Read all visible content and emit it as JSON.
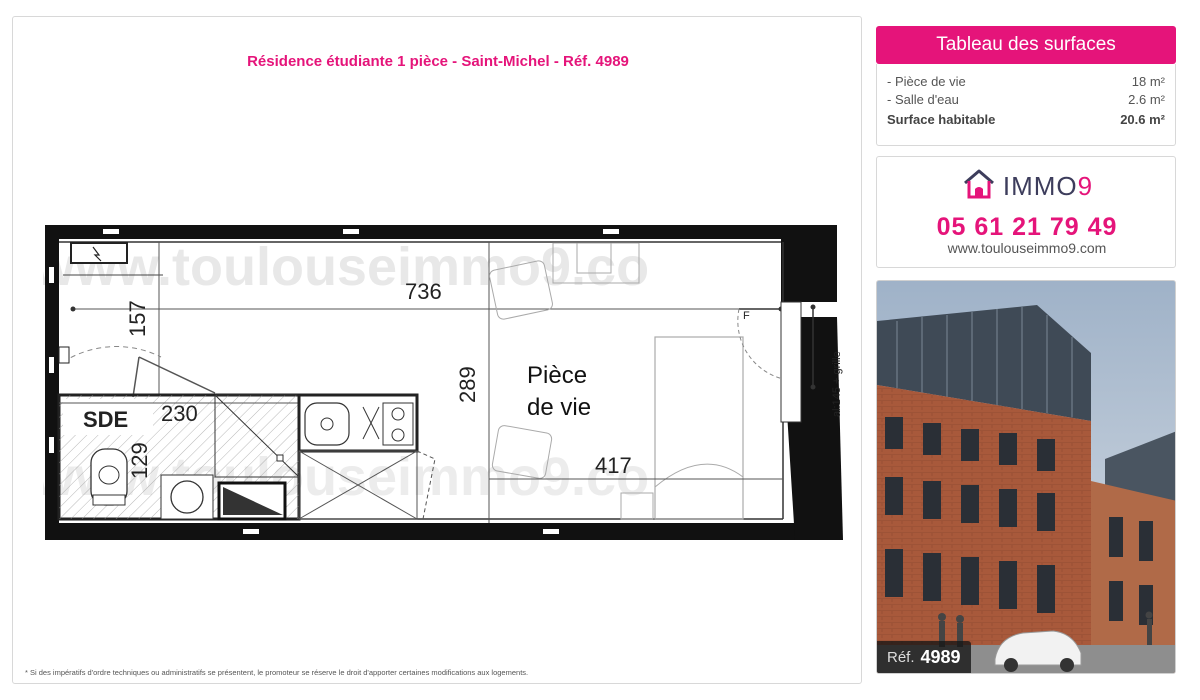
{
  "plan": {
    "title": "Résidence étudiante 1 pièce - Saint-Michel - Réf. 4989",
    "watermark": "www.toulouseimmo9.co",
    "room_label_line1": "Pièce",
    "room_label_line2": "de vie",
    "bath_label": "SDE",
    "dim_736": "736",
    "dim_157": "157",
    "dim_289": "289",
    "dim_230": "230",
    "dim_129": "129",
    "dim_417": "417",
    "window_label": "al:145 + grille",
    "fire_label": "F"
  },
  "footnote": "* Si des impératifs d'ordre techniques ou administratifs se présentent, le promoteur se réserve le droit d'apporter certaines modifications aux logements.",
  "surfaces": {
    "header": "Tableau des surfaces",
    "rows": [
      {
        "label": "- Pièce de vie",
        "value": "18 m²"
      },
      {
        "label": "- Salle d'eau",
        "value": "2.6 m²"
      }
    ],
    "total_label": "Surface habitable",
    "total_value": "20.6 m²"
  },
  "contact": {
    "logo_main": "IMMO",
    "logo_nine": "9",
    "phone": "05 61 21 79 49",
    "website": "www.toulouseimmo9.com",
    "logo_icon": "house-icon"
  },
  "photo": {
    "ref_label": "Réf.",
    "ref_number": "4989"
  },
  "colors": {
    "accent": "#e5147a",
    "logo_dark": "#3d3d5c"
  }
}
